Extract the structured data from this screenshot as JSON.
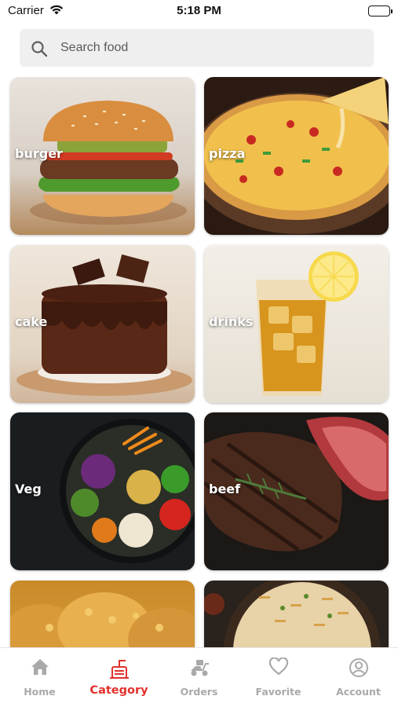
{
  "status_bar": {
    "carrier": "Carrier",
    "time": "5:18 PM"
  },
  "search": {
    "placeholder": "Search food",
    "icon": "search-icon"
  },
  "categories": [
    {
      "label": "burger"
    },
    {
      "label": "pizza"
    },
    {
      "label": "cake"
    },
    {
      "label": "drinks"
    },
    {
      "label": "Veg"
    },
    {
      "label": "beef"
    },
    {
      "label": ""
    },
    {
      "label": ""
    }
  ],
  "tabs": [
    {
      "label": "Home",
      "icon": "home-icon",
      "active": false
    },
    {
      "label": "Category",
      "icon": "category-icon",
      "active": true
    },
    {
      "label": "Orders",
      "icon": "delivery-icon",
      "active": false
    },
    {
      "label": "Favorite",
      "icon": "heart-icon",
      "active": false
    },
    {
      "label": "Account",
      "icon": "account-icon",
      "active": false
    }
  ],
  "colors": {
    "accent": "#e2312c",
    "inactive": "#a9a9a9",
    "search_bg": "#efefef"
  }
}
